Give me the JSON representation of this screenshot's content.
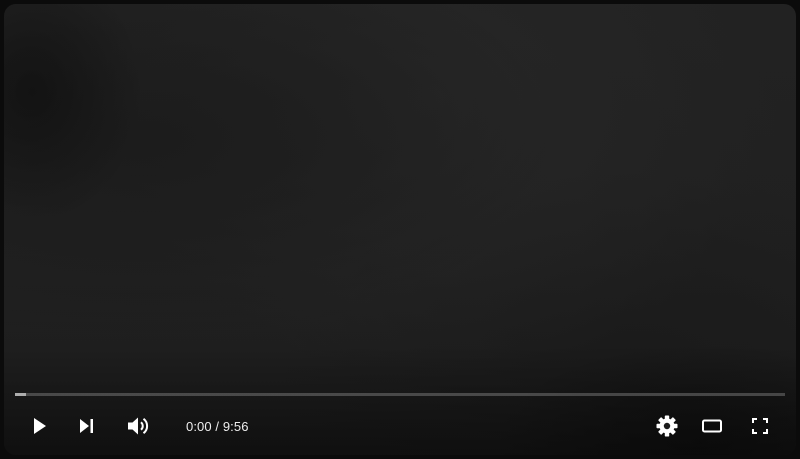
{
  "player": {
    "progress_fraction": 0.0,
    "buffered_fraction": 0.014
  },
  "controls": {
    "play_icon": "play-icon",
    "next_icon": "skip-next-icon",
    "volume_icon": "volume-icon",
    "settings_icon": "gear-icon",
    "theater_icon": "theater-mode-icon",
    "fullscreen_icon": "fullscreen-icon"
  },
  "time": {
    "current": "0:00",
    "separator": " / ",
    "duration": "9:56"
  },
  "colors": {
    "icon": "#ffffff",
    "time_text": "#eeeeee",
    "progress_played": "#ff0000"
  }
}
